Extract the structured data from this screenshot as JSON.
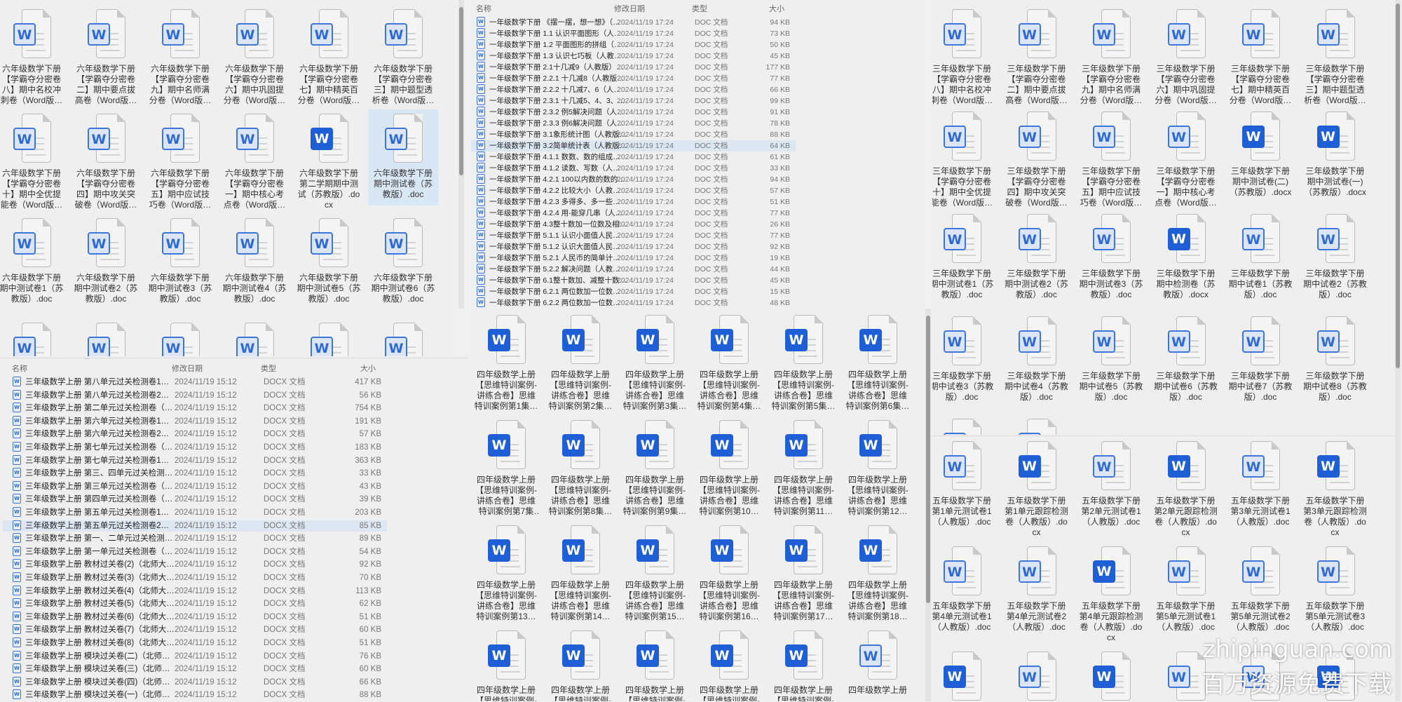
{
  "colors": {
    "selection": "#d9e6f3",
    "word_blue": "#1e5fd5"
  },
  "top_left_grid": {
    "items": [
      {
        "label": "六年级数学下册【学霸夺分密卷八】期中名校冲刺卷（Word版…",
        "icon": "doc"
      },
      {
        "label": "六年级数学下册【学霸夺分密卷二】期中要点拔高卷（Word版…",
        "icon": "doc"
      },
      {
        "label": "六年级数学下册【学霸夺分密卷九】期中名师满分卷（Word版…",
        "icon": "doc"
      },
      {
        "label": "六年级数学下册【学霸夺分密卷六】期中巩固提分卷（Word版…",
        "icon": "doc"
      },
      {
        "label": "六年级数学下册【学霸夺分密卷七】期中精英百分卷（Word版…",
        "icon": "doc"
      },
      {
        "label": "六年级数学下册【学霸夺分密卷三】期中题型透析卷（Word版…",
        "icon": "doc"
      },
      {
        "label": "六年级数学下册【学霸夺分密卷十】期中全优提能卷（Word版…",
        "icon": "doc"
      },
      {
        "label": "六年级数学下册【学霸夺分密卷四】期中攻关突破卷（Word版…",
        "icon": "doc"
      },
      {
        "label": "六年级数学下册【学霸夺分密卷五】期中应试技巧卷（Word版…",
        "icon": "doc"
      },
      {
        "label": "六年级数学下册【学霸夺分密卷一】期中核心考点卷（Word版…",
        "icon": "doc"
      },
      {
        "label": "六年级数学下册第二学期期中测试（苏教版）.docx",
        "icon": "docx"
      },
      {
        "label": "六年级数学下册期中测试卷（苏教版）.doc",
        "icon": "doc",
        "selected": true
      },
      {
        "label": "六年级数学下册期中测试卷1（苏教版）.doc",
        "icon": "doc"
      },
      {
        "label": "六年级数学下册期中测试卷2（苏教版）.doc",
        "icon": "doc"
      },
      {
        "label": "六年级数学下册期中测试卷3（苏教版）.doc",
        "icon": "doc"
      },
      {
        "label": "六年级数学下册期中测试卷4（苏教版）.doc",
        "icon": "doc"
      },
      {
        "label": "六年级数学下册期中测试卷5（苏教版）.doc",
        "icon": "doc"
      },
      {
        "label": "六年级数学下册期中测试卷6（苏教版）.doc",
        "icon": "doc"
      },
      {
        "icon": "doc"
      },
      {
        "icon": "doc"
      },
      {
        "icon": "doc"
      },
      {
        "icon": "doc"
      },
      {
        "icon": "doc"
      },
      {
        "icon": "doc"
      }
    ]
  },
  "top_middle_list": {
    "columns": {
      "name": "名称",
      "date": "修改日期",
      "type": "类型",
      "size": "大小"
    },
    "rows": [
      {
        "name": "一年级数学下册 《摆一摆，想一想》（…",
        "date": "2024/11/19 17:24",
        "type": "DOC 文档",
        "size": "94 KB"
      },
      {
        "name": "一年级数学下册 1.1 认识平面图形（人…",
        "date": "2024/11/19 17:24",
        "type": "DOC 文档",
        "size": "73 KB"
      },
      {
        "name": "一年级数学下册 1.2 平面图形的拼组（…",
        "date": "2024/11/19 17:24",
        "type": "DOC 文档",
        "size": "50 KB"
      },
      {
        "name": "一年级数学下册 1.3 认识七巧板（人教…",
        "date": "2024/11/19 17:24",
        "type": "DOC 文档",
        "size": "45 KB"
      },
      {
        "name": "一年级数学下册 2.1十几减9（人教版）…",
        "date": "2024/11/19 17:24",
        "type": "DOC 文档",
        "size": "177 KB"
      },
      {
        "name": "一年级数学下册 2.2.1 十几减8（人教版…",
        "date": "2024/11/19 17:24",
        "type": "DOC 文档",
        "size": "77 KB"
      },
      {
        "name": "一年级数学下册 2.2.2 十几减7、6（人…",
        "date": "2024/11/19 17:24",
        "type": "DOC 文档",
        "size": "66 KB"
      },
      {
        "name": "一年级数学下册 2.3.1 十几减5、4、3、…",
        "date": "2024/11/19 17:24",
        "type": "DOC 文档",
        "size": "99 KB"
      },
      {
        "name": "一年级数学下册 2.3.2 例5解决问题（人…",
        "date": "2024/11/19 17:24",
        "type": "DOC 文档",
        "size": "91 KB"
      },
      {
        "name": "一年级数学下册 2.3.3 例6解决问题（人…",
        "date": "2024/11/19 17:24",
        "type": "DOC 文档",
        "size": "78 KB"
      },
      {
        "name": "一年级数学下册 3.1象形统计图（人教版…",
        "date": "2024/11/19 17:24",
        "type": "DOC 文档",
        "size": "88 KB"
      },
      {
        "name": "一年级数学下册 3.2简单统计表（人教版…",
        "date": "2024/11/19 17:24",
        "type": "DOC 文档",
        "size": "64 KB",
        "selected": true
      },
      {
        "name": "一年级数学下册 4.1.1 数数、数的组成…",
        "date": "2024/11/19 17:24",
        "type": "DOC 文档",
        "size": "61 KB"
      },
      {
        "name": "一年级数学下册 4.1.2 读数、写数（人…",
        "date": "2024/11/19 17:24",
        "type": "DOC 文档",
        "size": "33 KB"
      },
      {
        "name": "一年级数学下册 4.2.1 100以内数的数的…",
        "date": "2024/11/19 17:24",
        "type": "DOC 文档",
        "size": "94 KB"
      },
      {
        "name": "一年级数学下册 4.2.2 比较大小（人教…",
        "date": "2024/11/19 17:24",
        "type": "DOC 文档",
        "size": "57 KB"
      },
      {
        "name": "一年级数学下册 4.2.3 多得多、多一些…",
        "date": "2024/11/19 17:24",
        "type": "DOC 文档",
        "size": "51 KB"
      },
      {
        "name": "一年级数学下册 4.2.4 用-能穿几串（人…",
        "date": "2024/11/19 17:24",
        "type": "DOC 文档",
        "size": "77 KB"
      },
      {
        "name": "一年级数学下册 4.3整十数加一位数及相…",
        "date": "2024/11/19 17:24",
        "type": "DOC 文档",
        "size": "26 KB"
      },
      {
        "name": "一年级数学下册 5.1.1 认识小面值人民…",
        "date": "2024/11/19 17:24",
        "type": "DOC 文档",
        "size": "77 KB"
      },
      {
        "name": "一年级数学下册 5.1.2 认识大面值人民…",
        "date": "2024/11/19 17:24",
        "type": "DOC 文档",
        "size": "92 KB"
      },
      {
        "name": "一年级数学下册 5.2.1 人民币的简单计…",
        "date": "2024/11/19 17:24",
        "type": "DOC 文档",
        "size": "19 KB"
      },
      {
        "name": "一年级数学下册 5.2.2 解决问题（人教…",
        "date": "2024/11/19 17:24",
        "type": "DOC 文档",
        "size": "44 KB"
      },
      {
        "name": "一年级数学下册 6.1整十数加、减整十数…",
        "date": "2024/11/19 17:24",
        "type": "DOC 文档",
        "size": "45 KB"
      },
      {
        "name": "一年级数学下册 6.2.1 两位数加一位数…",
        "date": "2024/11/19 17:24",
        "type": "DOC 文档",
        "size": "15 KB"
      },
      {
        "name": "一年级数学下册 6.2.2 两位数加一位数…",
        "date": "2024/11/19 17:24",
        "type": "DOC 文档",
        "size": "48 KB"
      }
    ]
  },
  "bottom_left_list": {
    "columns": {
      "name": "名称",
      "date": "修改日期",
      "type": "类型",
      "size": "大小"
    },
    "rows": [
      {
        "name": "三年级数学上册 第八单元过关检测卷1…",
        "date": "2024/11/19 15:12",
        "type": "DOCX 文档",
        "size": "417 KB"
      },
      {
        "name": "三年级数学上册 第八单元过关检测卷2…",
        "date": "2024/11/19 15:12",
        "type": "DOCX 文档",
        "size": "56 KB"
      },
      {
        "name": "三年级数学上册 第二单元过关检测卷（…",
        "date": "2024/11/19 15:12",
        "type": "DOCX 文档",
        "size": "754 KB"
      },
      {
        "name": "三年级数学上册 第六单元过关检测卷1…",
        "date": "2024/11/19 15:12",
        "type": "DOCX 文档",
        "size": "191 KB"
      },
      {
        "name": "三年级数学上册 第六单元过关检测卷2…",
        "date": "2024/11/19 15:12",
        "type": "DOCX 文档",
        "size": "57 KB"
      },
      {
        "name": "三年级数学上册 第七单元过关检测卷（…",
        "date": "2024/11/19 15:12",
        "type": "DOCX 文档",
        "size": "183 KB"
      },
      {
        "name": "三年级数学上册 第七单元过关检测卷1…",
        "date": "2024/11/19 15:12",
        "type": "DOCX 文档",
        "size": "363 KB"
      },
      {
        "name": "三年级数学上册 第三、四单元过关检测…",
        "date": "2024/11/19 15:12",
        "type": "DOCX 文档",
        "size": "33 KB"
      },
      {
        "name": "三年级数学上册 第三单元过关检测卷（…",
        "date": "2024/11/19 15:12",
        "type": "DOCX 文档",
        "size": "43 KB"
      },
      {
        "name": "三年级数学上册 第四单元过关检测卷（…",
        "date": "2024/11/19 15:12",
        "type": "DOCX 文档",
        "size": "39 KB"
      },
      {
        "name": "三年级数学上册 第五单元过关检测卷1…",
        "date": "2024/11/19 15:12",
        "type": "DOCX 文档",
        "size": "203 KB"
      },
      {
        "name": "三年级数学上册 第五单元过关检测卷2…",
        "date": "2024/11/19 15:12",
        "type": "DOCX 文档",
        "size": "85 KB",
        "selected": true
      },
      {
        "name": "三年级数学上册 第一、二单元过关检测…",
        "date": "2024/11/19 15:12",
        "type": "DOCX 文档",
        "size": "89 KB"
      },
      {
        "name": "三年级数学上册 第一单元过关检测卷（…",
        "date": "2024/11/19 15:12",
        "type": "DOCX 文档",
        "size": "54 KB"
      },
      {
        "name": "三年级数学上册 教材过关卷(2)（北师大…",
        "date": "2024/11/19 15:12",
        "type": "DOCX 文档",
        "size": "92 KB"
      },
      {
        "name": "三年级数学上册 教材过关卷(3)（北师大…",
        "date": "2024/11/19 15:12",
        "type": "DOCX 文档",
        "size": "70 KB"
      },
      {
        "name": "三年级数学上册 教材过关卷(4)（北师大…",
        "date": "2024/11/19 15:12",
        "type": "DOCX 文档",
        "size": "113 KB"
      },
      {
        "name": "三年级数学上册 教材过关卷(5)（北师大…",
        "date": "2024/11/19 15:12",
        "type": "DOCX 文档",
        "size": "62 KB"
      },
      {
        "name": "三年级数学上册 教材过关卷(6)（北师大…",
        "date": "2024/11/19 15:12",
        "type": "DOCX 文档",
        "size": "51 KB"
      },
      {
        "name": "三年级数学上册 教材过关卷(7)（北师大…",
        "date": "2024/11/19 15:12",
        "type": "DOCX 文档",
        "size": "60 KB"
      },
      {
        "name": "三年级数学上册 教材过关卷(8)（北师大…",
        "date": "2024/11/19 15:12",
        "type": "DOCX 文档",
        "size": "51 KB"
      },
      {
        "name": "三年级数学上册 模块过关卷(二)（北师…",
        "date": "2024/11/19 15:12",
        "type": "DOCX 文档",
        "size": "76 KB"
      },
      {
        "name": "三年级数学上册 模块过关卷(三)（北师…",
        "date": "2024/11/19 15:12",
        "type": "DOCX 文档",
        "size": "60 KB"
      },
      {
        "name": "三年级数学上册 模块过关卷(四)（北师…",
        "date": "2024/11/19 15:12",
        "type": "DOCX 文档",
        "size": "66 KB"
      },
      {
        "name": "三年级数学上册 模块过关卷(一)（北师…",
        "date": "2024/11/19 15:12",
        "type": "DOCX 文档",
        "size": "88 KB"
      }
    ]
  },
  "middle_grid": {
    "items": [
      {
        "label": "四年级数学上册【思维特训案例-讲练合卷】思维特训案例第1集…",
        "icon": "docx"
      },
      {
        "label": "四年级数学上册【思维特训案例-讲练合卷】思维特训案例第2集…",
        "icon": "docx"
      },
      {
        "label": "四年级数学上册【思维特训案例-讲练合卷】思维特训案例第3集…",
        "icon": "docx"
      },
      {
        "label": "四年级数学上册【思维特训案例-讲练合卷】思维特训案例第4集…",
        "icon": "docx"
      },
      {
        "label": "四年级数学上册【思维特训案例-讲练合卷】思维特训案例第5集…",
        "icon": "docx"
      },
      {
        "label": "四年级数学上册【思维特训案例-讲练合卷】思维特训案例第6集…",
        "icon": "docx"
      },
      {
        "label": "四年级数学上册【思维特训案例-讲练合卷】思维特训案例第7集 …",
        "icon": "docx"
      },
      {
        "label": "四年级数学上册【思维特训案例-讲练合卷】思维特训案例第8集…",
        "icon": "docx"
      },
      {
        "label": "四年级数学上册【思维特训案例-讲练合卷】思维特训案例第9集…",
        "icon": "docx"
      },
      {
        "label": "四年级数学上册【思维特训案例-讲练合卷】思维特训案例第10…",
        "icon": "docx"
      },
      {
        "label": "四年级数学上册【思维特训案例-讲练合卷】思维特训案例第11…",
        "icon": "docx"
      },
      {
        "label": "四年级数学上册【思维特训案例-讲练合卷】思维特训案例第12…",
        "icon": "docx"
      },
      {
        "label": "四年级数学上册【思维特训案例-讲练合卷】思维特训案例第13…",
        "icon": "docx"
      },
      {
        "label": "四年级数学上册【思维特训案例-讲练合卷】思维特训案例第14…",
        "icon": "docx"
      },
      {
        "label": "四年级数学上册【思维特训案例-讲练合卷】思维特训案例第15…",
        "icon": "docx"
      },
      {
        "label": "四年级数学上册【思维特训案例-讲练合卷】思维特训案例第16…",
        "icon": "docx"
      },
      {
        "label": "四年级数学上册【思维特训案例-讲练合卷】思维特训案例第17…",
        "icon": "docx"
      },
      {
        "label": "四年级数学上册【思维特训案例-讲练合卷】思维特训案例第18…",
        "icon": "docx"
      },
      {
        "label": "四年级数学上册【思维特训案例-",
        "icon": "docx"
      },
      {
        "label": "四年级数学上册【思维特训案例-",
        "icon": "docx"
      },
      {
        "label": "四年级数学上册【思维特训案例-",
        "icon": "docx"
      },
      {
        "label": "四年级数学上册【思维特训案例-",
        "icon": "docx"
      },
      {
        "label": "四年级数学上册【思维特训案例-",
        "icon": "docx"
      },
      {
        "label": "四年级数学上册",
        "icon": "doc"
      }
    ]
  },
  "right_upper_grid": {
    "items": [
      {
        "label": "三年级数学下册【学霸夺分密卷八】期中名校冲刺卷（Word版…",
        "icon": "doc"
      },
      {
        "label": "三年级数学下册【学霸夺分密卷二】期中要点拔高卷（Word版…",
        "icon": "doc"
      },
      {
        "label": "三年级数学下册【学霸夺分密卷九】期中名师满分卷（Word版…",
        "icon": "doc"
      },
      {
        "label": "三年级数学下册【学霸夺分密卷六】期中巩固提分卷（Word版…",
        "icon": "doc"
      },
      {
        "label": "三年级数学下册【学霸夺分密卷七】期中精英百分卷（Word版…",
        "icon": "doc"
      },
      {
        "label": "三年级数学下册【学霸夺分密卷三】期中题型透析卷（Word版…",
        "icon": "doc"
      },
      {
        "label": "三年级数学下册【学霸夺分密卷十】期中全优提能卷（Word版…",
        "icon": "doc"
      },
      {
        "label": "三年级数学下册【学霸夺分密卷四】期中攻关突破卷（Word版…",
        "icon": "doc"
      },
      {
        "label": "三年级数学下册【学霸夺分密卷五】期中应试技巧卷（Word版…",
        "icon": "doc"
      },
      {
        "label": "三年级数学下册【学霸夺分密卷一】期中核心考点卷（Word版…",
        "icon": "doc"
      },
      {
        "label": "三年级数学下册期中测试卷(二)（苏教版）.docx",
        "icon": "docx"
      },
      {
        "label": "三年级数学下册期中测试卷(一)（苏教版）.docx",
        "icon": "docx"
      },
      {
        "label": "三年级数学下册期中测试卷1（苏教版）.doc",
        "icon": "doc"
      },
      {
        "label": "三年级数学下册期中测试卷2（苏教版）.doc",
        "icon": "doc"
      },
      {
        "label": "三年级数学下册期中测试卷3（苏教版）.doc",
        "icon": "doc"
      },
      {
        "label": "三年级数学下册期中检测卷（苏教版）.docx",
        "icon": "docx"
      },
      {
        "label": "三年级数学下册期中试卷1（苏教版）.doc",
        "icon": "doc"
      },
      {
        "label": "三年级数学下册期中试卷2（苏教版）.doc",
        "icon": "doc"
      },
      {
        "label": "三年级数学下册期中试卷3（苏教版）.doc",
        "icon": "doc"
      },
      {
        "label": "三年级数学下册期中试卷4（苏教版）.doc",
        "icon": "doc"
      },
      {
        "label": "三年级数学下册期中试卷5（苏教版）.doc",
        "icon": "doc"
      },
      {
        "label": "三年级数学下册期中试卷6（苏教版）.doc",
        "icon": "doc"
      },
      {
        "label": "三年级数学下册期中试卷7（苏教版）.doc",
        "icon": "doc"
      },
      {
        "label": "三年级数学下册期中试卷8（苏教版）.doc",
        "icon": "doc"
      },
      {
        "icon": "doc"
      },
      {
        "icon": "doc"
      }
    ]
  },
  "right_lower_grid": {
    "items": [
      {
        "label": "五年级数学下册第1单元测试卷1（人教版）.doc",
        "icon": "doc"
      },
      {
        "label": "五年级数学下册第1单元跟踪检测卷（人教版）.docx",
        "icon": "docx"
      },
      {
        "label": "五年级数学下册第2单元测试卷1（人教版）.doc",
        "icon": "doc"
      },
      {
        "label": "五年级数学下册第2单元跟踪检测卷（人教版）.docx",
        "icon": "docx"
      },
      {
        "label": "五年级数学下册第3单元测试卷1（人教版）.doc",
        "icon": "doc"
      },
      {
        "label": "五年级数学下册第3单元跟踪检测卷（人教版）.docx",
        "icon": "docx"
      },
      {
        "label": "五年级数学下册第4单元测试卷1（人教版）.doc",
        "icon": "doc"
      },
      {
        "label": "五年级数学下册第4单元测试卷2（人教版）.doc",
        "icon": "doc"
      },
      {
        "label": "五年级数学下册第4单元跟踪检测卷（人教版）.docx",
        "icon": "docx"
      },
      {
        "label": "五年级数学下册第5单元测试卷1（人教版）.doc",
        "icon": "doc"
      },
      {
        "label": "五年级数学下册第5单元测试卷2（人教版）.doc",
        "icon": "doc"
      },
      {
        "label": "五年级数学下册第5单元测试卷3（人教版）.doc",
        "icon": "doc"
      },
      {
        "icon": "docx"
      },
      {
        "icon": "doc"
      },
      {
        "icon": "docx"
      },
      {
        "icon": "doc"
      },
      {
        "icon": "doc"
      },
      {
        "icon": "docx"
      }
    ]
  },
  "watermark": {
    "domain": "zhipinguan.com",
    "slogan": "百万资源免费下载"
  }
}
